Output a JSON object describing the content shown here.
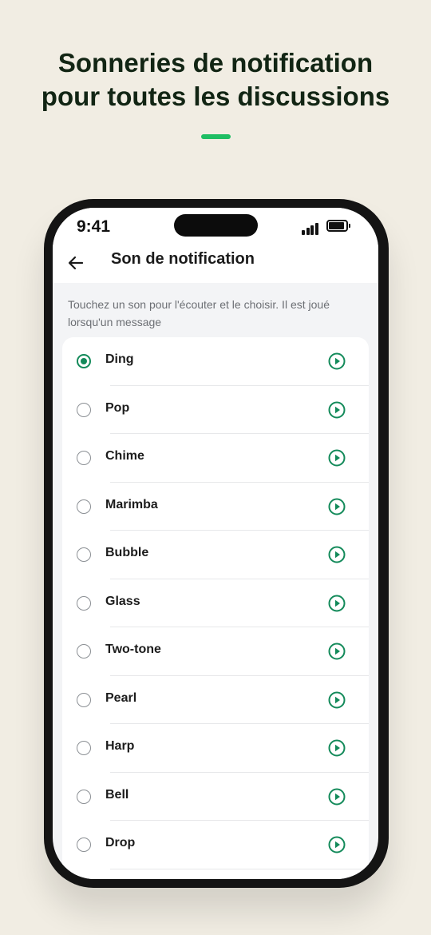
{
  "headline": {
    "line1": "Sonneries de notification",
    "line2": "pour toutes les discussions"
  },
  "colors": {
    "background": "#f1ede3",
    "accent": "#1fbe63",
    "brand_green": "#138a5a",
    "headline": "#122514"
  },
  "status_bar": {
    "time": "9:41",
    "icons": [
      "signal-icon",
      "battery-icon"
    ]
  },
  "app_bar": {
    "back_icon": "arrow-left-icon",
    "title": "Son de notification"
  },
  "description": "Touchez un son pour l'écouter et le choisir. Il est joué lorsqu'un message",
  "sounds": [
    {
      "label": "Ding",
      "selected": true
    },
    {
      "label": "Pop",
      "selected": false
    },
    {
      "label": "Chime",
      "selected": false
    },
    {
      "label": "Marimba",
      "selected": false
    },
    {
      "label": "Bubble",
      "selected": false
    },
    {
      "label": "Glass",
      "selected": false
    },
    {
      "label": "Two-tone",
      "selected": false
    },
    {
      "label": "Pearl",
      "selected": false
    },
    {
      "label": "Harp",
      "selected": false
    },
    {
      "label": "Bell",
      "selected": false
    },
    {
      "label": "Drop",
      "selected": false
    }
  ]
}
